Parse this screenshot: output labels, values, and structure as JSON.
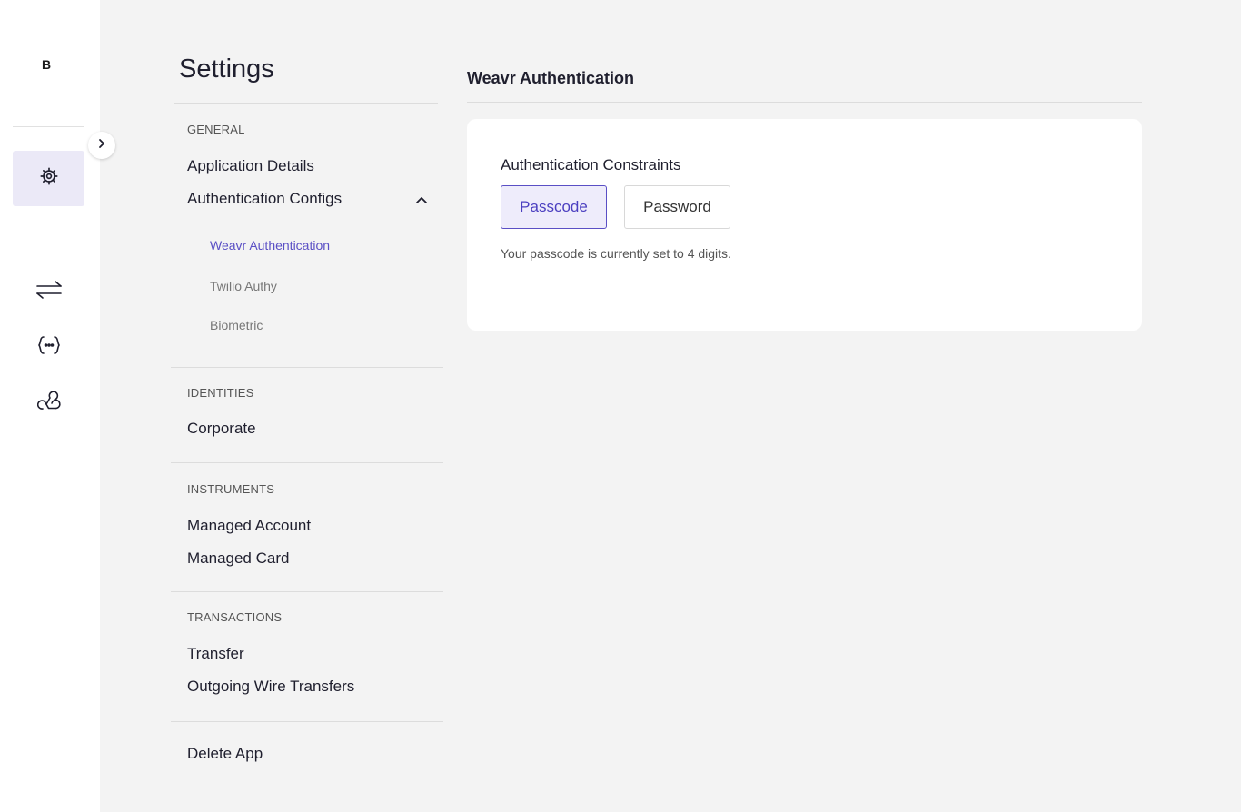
{
  "rail": {
    "avatar_letter": "B",
    "icons": [
      "chevron-right-icon",
      "settings-gear-icon",
      "transfer-arrows-icon",
      "code-braces-icon",
      "webhook-icon"
    ]
  },
  "settings_nav": {
    "title": "Settings",
    "sections": [
      {
        "label": "GENERAL",
        "items": [
          "Application Details",
          "Authentication Configs"
        ]
      },
      {
        "label": "IDENTITIES",
        "items": [
          "Corporate"
        ]
      },
      {
        "label": "INSTRUMENTS",
        "items": [
          "Managed Account",
          "Managed Card"
        ]
      },
      {
        "label": "TRANSACTIONS",
        "items": [
          "Transfer",
          "Outgoing Wire Transfers"
        ]
      }
    ],
    "auth_sub_items": [
      "Weavr Authentication",
      "Twilio Authy",
      "Biometric"
    ],
    "active_sub_item": "Weavr Authentication",
    "delete_app": "Delete App"
  },
  "content": {
    "title": "Weavr Authentication",
    "constraints_label": "Authentication Constraints",
    "options": [
      "Passcode",
      "Password"
    ],
    "selected_option": "Passcode",
    "hint": "Your passcode is currently set to 4 digits."
  },
  "colors": {
    "accent": "#5a4fc5",
    "accent_bg": "#eeecfb",
    "page_bg": "#f3f3f3"
  }
}
